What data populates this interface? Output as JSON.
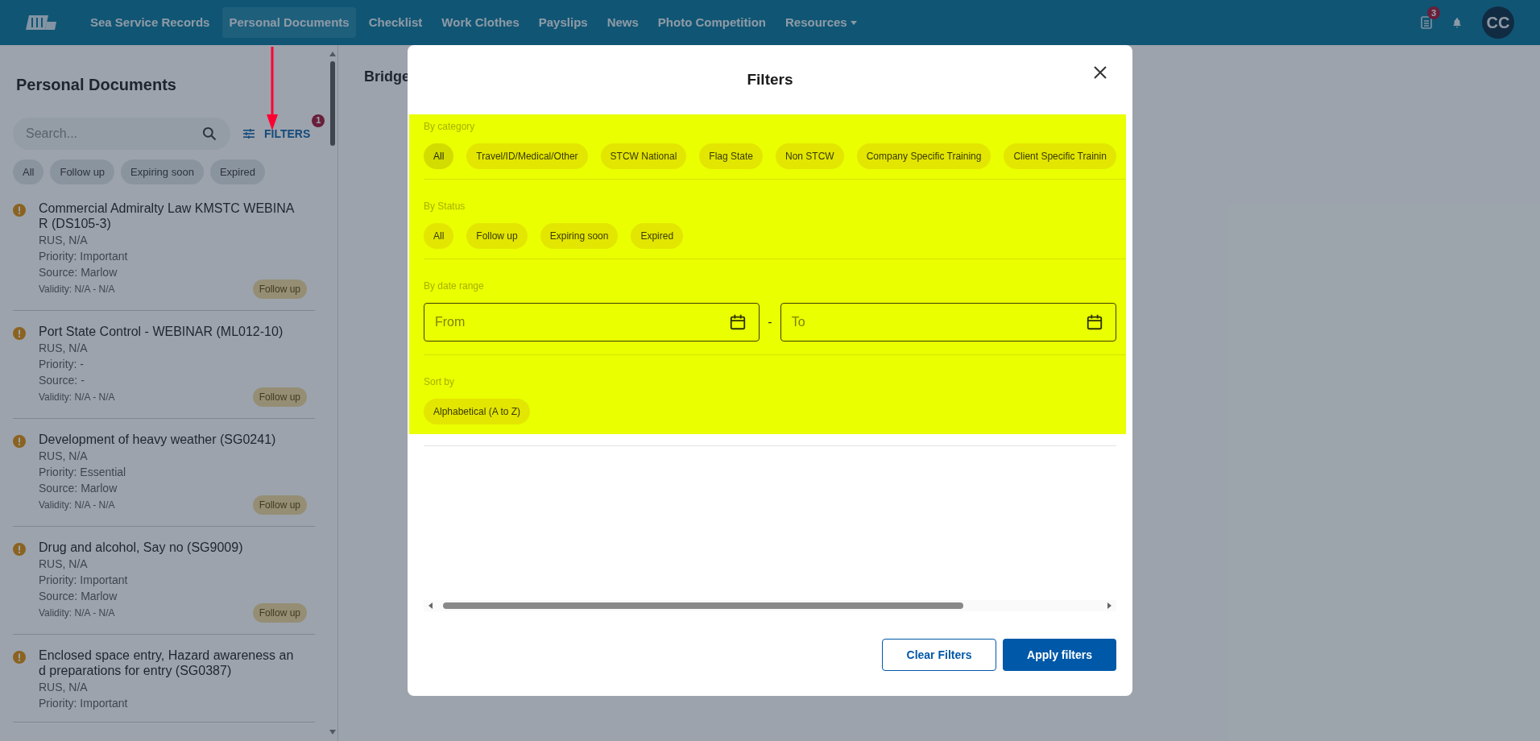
{
  "nav": {
    "items": [
      {
        "label": "Sea Service Records",
        "selected": false,
        "kind": "link"
      },
      {
        "label": "Personal Documents",
        "selected": true,
        "kind": "link"
      },
      {
        "label": "Checklist",
        "selected": false,
        "kind": "link"
      },
      {
        "label": "Work Clothes",
        "selected": false,
        "kind": "link"
      },
      {
        "label": "Payslips",
        "selected": false,
        "kind": "link"
      },
      {
        "label": "News",
        "selected": false,
        "kind": "link"
      },
      {
        "label": "Photo Competition",
        "selected": false,
        "kind": "link"
      },
      {
        "label": "Resources",
        "selected": false,
        "kind": "dropdown"
      }
    ],
    "documents_badge": "3",
    "avatar": "CC"
  },
  "sidebar": {
    "title": "Personal Documents",
    "search": {
      "placeholder": "Search..."
    },
    "filters_button": "FILTERS",
    "filters_badge": "1",
    "quick_filters": [
      "All",
      "Follow up",
      "Expiring soon",
      "Expired"
    ],
    "documents": [
      {
        "title": "Commercial Admiralty Law KMSTC WEBINA R (DS105-3)",
        "details": [
          "RUS, N/A",
          "Priority: Important",
          "Source: Marlow"
        ],
        "validity": "Validity: N/A - N/A",
        "status": "Follow up"
      },
      {
        "title": "Port State Control - WEBINAR (ML012-10)",
        "details": [
          "RUS, N/A",
          "Priority: -",
          "Source: -"
        ],
        "validity": "Validity: N/A - N/A",
        "status": "Follow up"
      },
      {
        "title": "Development of heavy weather (SG0241)",
        "details": [
          "RUS, N/A",
          "Priority: Essential",
          "Source: Marlow"
        ],
        "validity": "Validity: N/A - N/A",
        "status": "Follow up"
      },
      {
        "title": "Drug and alcohol, Say no (SG9009)",
        "details": [
          "RUS, N/A",
          "Priority: Important",
          "Source: Marlow"
        ],
        "validity": "Validity: N/A - N/A",
        "status": "Follow up"
      },
      {
        "title": "Enclosed space entry, Hazard awareness an d preparations for entry (SG0387)",
        "details": [
          "RUS, N/A",
          "Priority: Important"
        ]
      }
    ]
  },
  "main": {
    "title": "Bridge"
  },
  "modal": {
    "title": "Filters",
    "sections": [
      {
        "kind": "chips",
        "label": "By category",
        "chips": [
          {
            "label": "All",
            "selected": true
          },
          {
            "label": "Travel/ID/Medical/Other",
            "selected": false
          },
          {
            "label": "STCW National",
            "selected": false
          },
          {
            "label": "Flag State",
            "selected": false
          },
          {
            "label": "Non STCW",
            "selected": false
          },
          {
            "label": "Company Specific Training",
            "selected": false
          },
          {
            "label": "Client Specific Trainin",
            "selected": false
          }
        ]
      },
      {
        "kind": "chips",
        "label": "By Status",
        "chips": [
          {
            "label": "All",
            "selected": false
          },
          {
            "label": "Follow up",
            "selected": false
          },
          {
            "label": "Expiring soon",
            "selected": false
          },
          {
            "label": "Expired",
            "selected": false
          }
        ]
      },
      {
        "kind": "dates",
        "label": "By date range",
        "from": {
          "placeholder": "From"
        },
        "separator": "-",
        "to": {
          "placeholder": "To"
        }
      },
      {
        "kind": "chips",
        "label": "Sort by",
        "chips": [
          {
            "label": "Alphabetical (A to Z)",
            "selected": false
          }
        ]
      }
    ],
    "buttons": [
      {
        "label": "Clear Filters",
        "kind": "secondary"
      },
      {
        "label": "Apply filters",
        "kind": "primary"
      }
    ]
  }
}
